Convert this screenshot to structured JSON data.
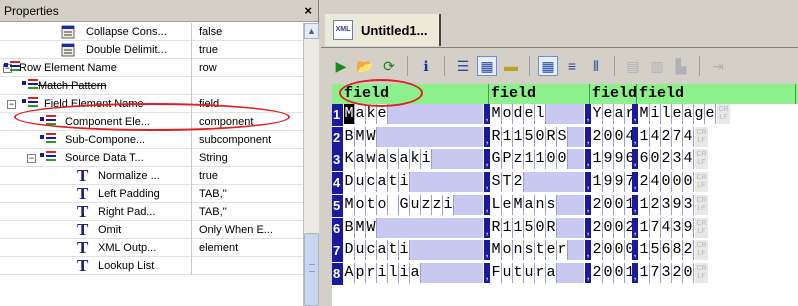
{
  "properties": {
    "title": "Properties",
    "close": "×",
    "rows": [
      {
        "label": "Collapse Cons...",
        "value": "false"
      },
      {
        "label": "Double Delimit...",
        "value": "true"
      },
      {
        "label": "Row Element Name",
        "value": "row"
      },
      {
        "label": "Match Pattern",
        "value": ""
      },
      {
        "label": "Field Element Name",
        "value": "field"
      },
      {
        "label": "Component Ele...",
        "value": "component"
      },
      {
        "label": "Sub-Compone...",
        "value": "subcomponent"
      },
      {
        "label": "Source Data T...",
        "value": "String"
      },
      {
        "label": "Normalize ...",
        "value": "true"
      },
      {
        "label": "Left Padding",
        "value": "TAB,''"
      },
      {
        "label": "Right Pad...",
        "value": "TAB,''"
      },
      {
        "label": "Omit",
        "value": "Only When E..."
      },
      {
        "label": "XML Outp...",
        "value": "element"
      },
      {
        "label": "Lookup List",
        "value": ""
      }
    ]
  },
  "editor": {
    "tab_title": "Untitled1...",
    "tab_icon_text": "XML",
    "toolbar": [
      {
        "name": "run-icon",
        "glyph": "▶"
      },
      {
        "name": "open-icon",
        "glyph": "📂"
      },
      {
        "name": "refresh-icon",
        "glyph": "⟳"
      },
      {
        "name": "info-icon",
        "glyph": "ℹ"
      },
      {
        "name": "list-icon",
        "glyph": "☰"
      },
      {
        "name": "hex-icon",
        "glyph": "▦"
      },
      {
        "name": "line-icon",
        "glyph": "▬"
      },
      {
        "name": "grid-layout-icon",
        "glyph": "▦"
      },
      {
        "name": "rows-icon",
        "glyph": "≡"
      },
      {
        "name": "columns-icon",
        "glyph": "⦀"
      },
      {
        "name": "table-icon",
        "glyph": "▤"
      },
      {
        "name": "column-chart-icon",
        "glyph": "▥"
      },
      {
        "name": "bar-chart-icon",
        "glyph": "▙"
      },
      {
        "name": "indent-icon",
        "glyph": "⇥"
      }
    ],
    "headers": [
      "field",
      "field",
      "field",
      "field"
    ],
    "rows": [
      {
        "num": "1",
        "cells": [
          "Make",
          "Model",
          "Year",
          "Mileage"
        ]
      },
      {
        "num": "2",
        "cells": [
          "BMW",
          "R1150RS",
          "2004",
          "14274"
        ]
      },
      {
        "num": "3",
        "cells": [
          "Kawasaki",
          "GPz1100",
          "1996",
          "60234"
        ]
      },
      {
        "num": "4",
        "cells": [
          "Ducati",
          "ST2",
          "1997",
          "24000"
        ]
      },
      {
        "num": "5",
        "cells": [
          "Moto Guzzi",
          "LeMans",
          "2001",
          "12393"
        ]
      },
      {
        "num": "6",
        "cells": [
          "BMW",
          "R1150R",
          "2002",
          "17439"
        ]
      },
      {
        "num": "7",
        "cells": [
          "Ducati",
          "Monster",
          "2000",
          "15682"
        ]
      },
      {
        "num": "8",
        "cells": [
          "Aprilia",
          "Futura",
          "2001",
          "17320"
        ]
      }
    ],
    "comma": ",",
    "eol_marker": "CR LF"
  }
}
